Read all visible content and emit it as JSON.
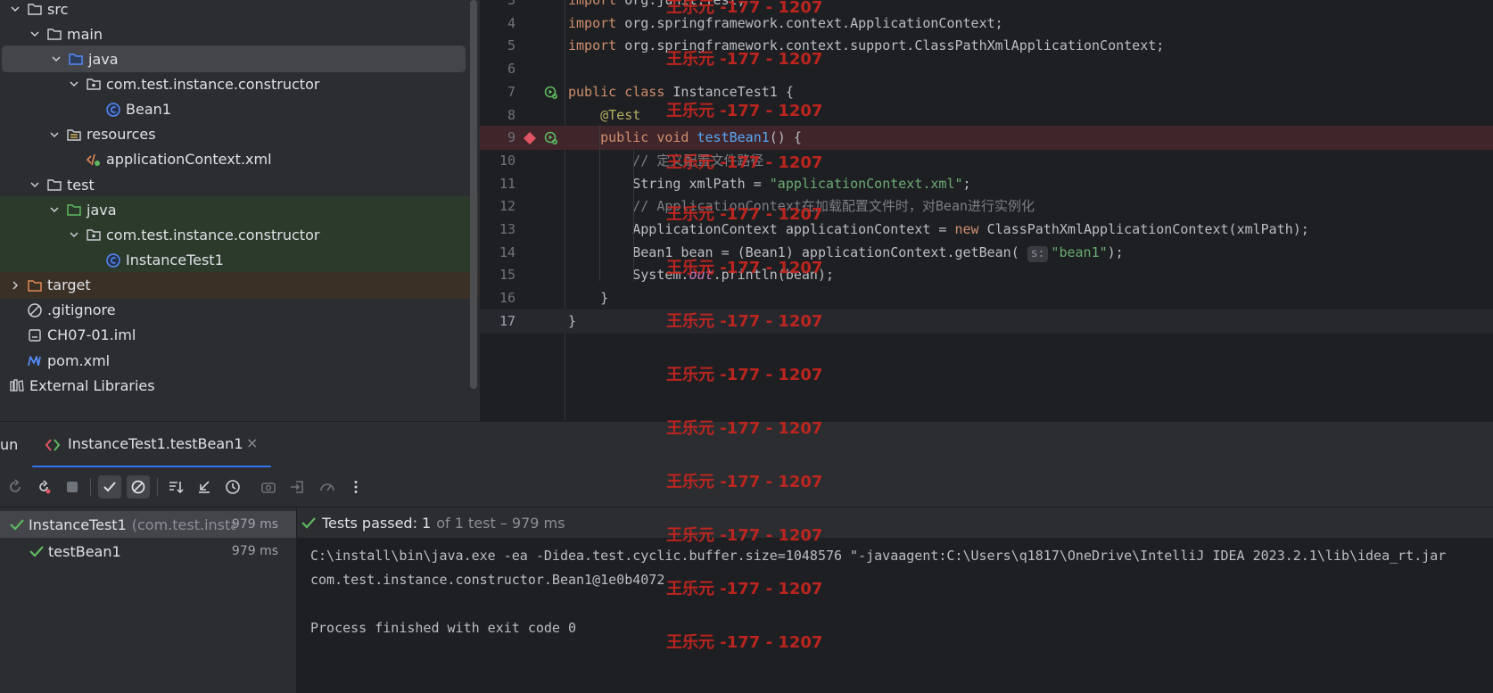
{
  "project_tree": {
    "items": [
      {
        "label": "src",
        "depth": 0,
        "expanded": true,
        "icon": "folder-icon"
      },
      {
        "label": "main",
        "depth": 1,
        "expanded": true,
        "icon": "folder-icon"
      },
      {
        "label": "java",
        "depth": 2,
        "expanded": true,
        "icon": "source-folder-icon",
        "selected": true
      },
      {
        "label": "com.test.instance.constructor",
        "depth": 3,
        "expanded": true,
        "icon": "package-icon"
      },
      {
        "label": "Bean1",
        "depth": 4,
        "icon": "class-icon"
      },
      {
        "label": "resources",
        "depth": 2,
        "expanded": true,
        "icon": "resources-folder-icon"
      },
      {
        "label": "applicationContext.xml",
        "depth": 3,
        "icon": "xml-file-icon"
      },
      {
        "label": "test",
        "depth": 1,
        "expanded": true,
        "icon": "folder-icon"
      },
      {
        "label": "java",
        "depth": 2,
        "expanded": true,
        "icon": "test-source-folder-icon",
        "tint": "test"
      },
      {
        "label": "com.test.instance.constructor",
        "depth": 3,
        "expanded": true,
        "icon": "package-icon",
        "tint": "test"
      },
      {
        "label": "InstanceTest1",
        "depth": 4,
        "icon": "class-icon",
        "tint": "test"
      },
      {
        "label": "target",
        "depth": 0,
        "expanded": false,
        "icon": "excluded-folder-icon",
        "tint": "excluded"
      },
      {
        "label": ".gitignore",
        "depth": 0,
        "icon": "ignored-file-icon"
      },
      {
        "label": "CH07-01.iml",
        "depth": 0,
        "icon": "module-file-icon"
      },
      {
        "label": "pom.xml",
        "depth": 0,
        "icon": "maven-icon"
      },
      {
        "label": "External Libraries",
        "depth": -1,
        "icon": "libraries-icon"
      }
    ]
  },
  "editor": {
    "lines": [
      {
        "num": "3",
        "segs": [
          [
            "kw",
            "import "
          ],
          [
            "",
            "org.junit.Test;"
          ]
        ]
      },
      {
        "num": "4",
        "segs": [
          [
            "kw",
            "import "
          ],
          [
            "",
            "org.springframework.context.ApplicationContext;"
          ]
        ]
      },
      {
        "num": "5",
        "segs": [
          [
            "kw",
            "import "
          ],
          [
            "",
            "org.springframework.context.support.ClassPathXmlApplicationContext;"
          ]
        ]
      },
      {
        "num": "6",
        "segs": []
      },
      {
        "num": "7",
        "segs": [
          [
            "kw",
            "public class "
          ],
          [
            "",
            "InstanceTest1 {"
          ]
        ],
        "run_icon": true
      },
      {
        "num": "8",
        "segs": [
          [
            "",
            "    "
          ],
          [
            "ann",
            "@Test"
          ]
        ]
      },
      {
        "num": "9",
        "segs": [
          [
            "",
            "    "
          ],
          [
            "kw",
            "public void "
          ],
          [
            "fn",
            "testBean1"
          ],
          [
            "",
            "() {"
          ]
        ],
        "run_icon": true,
        "breakpoint": true
      },
      {
        "num": "10",
        "segs": [
          [
            "",
            "        "
          ],
          [
            "cmt",
            "// 定义配置文件路径"
          ]
        ]
      },
      {
        "num": "11",
        "segs": [
          [
            "",
            "        String xmlPath = "
          ],
          [
            "str",
            "\"applicationContext.xml\""
          ],
          [
            "",
            ";"
          ]
        ]
      },
      {
        "num": "12",
        "segs": [
          [
            "",
            "        "
          ],
          [
            "cmt",
            "// ApplicationContext在加载配置文件时，对Bean进行实例化"
          ]
        ]
      },
      {
        "num": "13",
        "segs": [
          [
            "",
            "        ApplicationContext applicationContext = "
          ],
          [
            "kw",
            "new "
          ],
          [
            "",
            "ClassPathXmlApplicationContext(xmlPath);"
          ]
        ]
      },
      {
        "num": "14",
        "segs": [
          [
            "",
            "        Bean1 bean = (Bean1) applicationContext.getBean( "
          ],
          [
            "hint",
            "s:"
          ],
          [
            "str",
            "\"bean1\""
          ],
          [
            "",
            ");"
          ]
        ]
      },
      {
        "num": "15",
        "segs": [
          [
            "",
            "        System."
          ],
          [
            "fld",
            "out"
          ],
          [
            "",
            ".println(bean);"
          ]
        ]
      },
      {
        "num": "16",
        "segs": [
          [
            "",
            "    }"
          ]
        ]
      },
      {
        "num": "17",
        "segs": [
          [
            "",
            "}"
          ]
        ],
        "current": true
      }
    ]
  },
  "run_panel": {
    "label": "un",
    "tab_title": "InstanceTest1.testBean1",
    "close_glyph": "×",
    "status_passed": "Tests passed: 1",
    "status_detail": "of 1 test – 979 ms",
    "tests": [
      {
        "name": "InstanceTest1",
        "package": "(com.test.insta",
        "duration": "979 ms"
      },
      {
        "name": "testBean1",
        "duration": "979 ms"
      }
    ],
    "console": [
      "C:\\install\\bin\\java.exe -ea -Didea.test.cyclic.buffer.size=1048576 \"-javaagent:C:\\Users\\q1817\\OneDrive\\IntelliJ IDEA 2023.2.1\\lib\\idea_rt.jar",
      "com.test.instance.constructor.Bean1@1e0b4072",
      "",
      "Process finished with exit code 0"
    ]
  },
  "watermark": "王乐元 -177 - 1207",
  "colors": {
    "accent": "#3574f0",
    "keyword": "#cf8e6d",
    "string": "#6aab73",
    "success": "#5fb85f",
    "breakpoint": "#e05562",
    "watermark": "#c8261f"
  }
}
